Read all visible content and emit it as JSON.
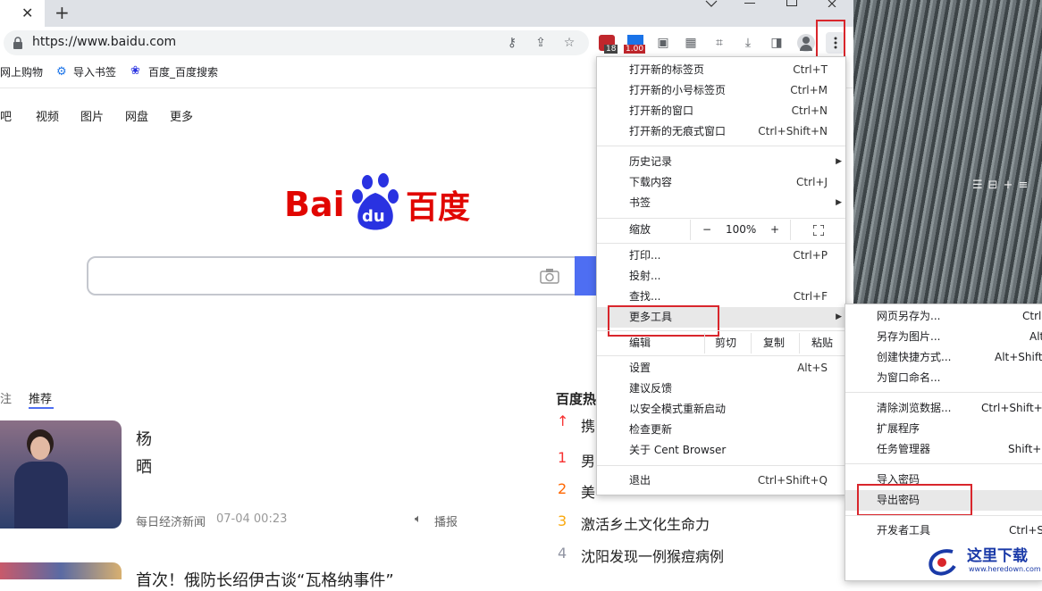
{
  "browser": {
    "new_tab_symbol": "+",
    "close_tab_symbol": "✕",
    "url": "https://www.baidu.com",
    "badges": {
      "ext1": "18",
      "ext2": "1.00"
    },
    "bookmarks": [
      {
        "label": "网上购物",
        "icon": ""
      },
      {
        "label": "导入书签",
        "icon": "gear-icon"
      },
      {
        "label": "百度_百度搜索",
        "icon": "paw-icon"
      }
    ]
  },
  "page": {
    "nav": [
      "吧",
      "视频",
      "图片",
      "网盘",
      "更多"
    ],
    "logo_text": {
      "bai": "Bai",
      "du": "du",
      "cn": "百度"
    },
    "tabs": [
      "注",
      "推荐"
    ],
    "news": [
      {
        "title_line1": "杨",
        "title_line2": "晒",
        "source": "每日经济新闻",
        "time": "07-04 00:23",
        "action": "播报"
      },
      {
        "title_line1": "首次！俄防长绍伊古谈“瓦格纳事件”"
      }
    ],
    "hot_title": "百度热",
    "hot_items": [
      {
        "rank": "",
        "text": "携"
      },
      {
        "rank": "1",
        "text": "男"
      },
      {
        "rank": "2",
        "text": "美"
      },
      {
        "rank": "3",
        "text": "激活乡土文化生命力"
      },
      {
        "rank": "4",
        "text": "沈阳发现一例猴痘病例"
      }
    ]
  },
  "menu": {
    "items": [
      {
        "label": "打开新的标签页",
        "shortcut": "Ctrl+T"
      },
      {
        "label": "打开新的小号标签页",
        "shortcut": "Ctrl+M"
      },
      {
        "label": "打开新的窗口",
        "shortcut": "Ctrl+N"
      },
      {
        "label": "打开新的无痕式窗口",
        "shortcut": "Ctrl+Shift+N"
      },
      {
        "label": "历史记录",
        "shortcut": ""
      },
      {
        "label": "下载内容",
        "shortcut": "Ctrl+J"
      },
      {
        "label": "书签",
        "shortcut": ""
      },
      {
        "label": "打印...",
        "shortcut": "Ctrl+P"
      },
      {
        "label": "投射...",
        "shortcut": ""
      },
      {
        "label": "查找...",
        "shortcut": "Ctrl+F"
      },
      {
        "label": "更多工具",
        "shortcut": ""
      },
      {
        "label": "设置",
        "shortcut": "Alt+S"
      },
      {
        "label": "建议反馈",
        "shortcut": ""
      },
      {
        "label": "以安全模式重新启动",
        "shortcut": ""
      },
      {
        "label": "检查更新",
        "shortcut": ""
      },
      {
        "label": "关于 Cent Browser",
        "shortcut": ""
      },
      {
        "label": "退出",
        "shortcut": "Ctrl+Shift+Q"
      }
    ],
    "zoom": {
      "label": "缩放",
      "minus": "−",
      "value": "100%",
      "plus": "+"
    },
    "edit": {
      "label": "编辑",
      "cut": "剪切",
      "copy": "复制",
      "paste": "粘贴"
    }
  },
  "submenu": {
    "items": [
      {
        "label": "网页另存为...",
        "shortcut": "Ctrl"
      },
      {
        "label": "另存为图片...",
        "shortcut": "Alt"
      },
      {
        "label": "创建快捷方式...",
        "shortcut": "Alt+Shift"
      },
      {
        "label": "为窗口命名...",
        "shortcut": ""
      },
      {
        "label": "清除浏览数据...",
        "shortcut": "Ctrl+Shift+"
      },
      {
        "label": "扩展程序",
        "shortcut": ""
      },
      {
        "label": "任务管理器",
        "shortcut": "Shift+"
      },
      {
        "label": "导入密码",
        "shortcut": ""
      },
      {
        "label": "导出密码",
        "shortcut": ""
      },
      {
        "label": "开发者工具",
        "shortcut": "Ctrl+Shift"
      }
    ]
  },
  "watermark": {
    "cn": "这里下载",
    "url": "www.heredown.com"
  },
  "colors": {
    "accent": "#4e6ef2",
    "baidu_red": "#e10601",
    "baidu_blue": "#2932e1",
    "highlight": "#d9262c"
  }
}
